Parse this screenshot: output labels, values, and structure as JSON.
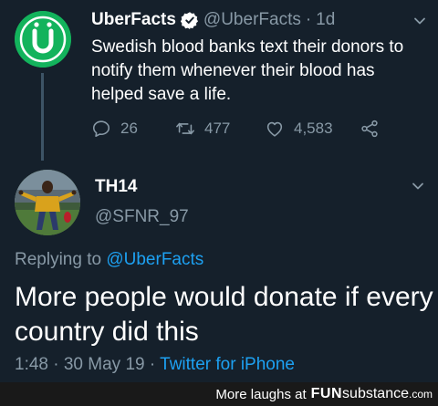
{
  "parent_tweet": {
    "name": "UberFacts",
    "handle": "@UberFacts",
    "separator": "·",
    "time": "1d",
    "text": "Swedish blood banks text their donors to notify them whenever their blood has helped save a life.",
    "replies": "26",
    "retweets": "477",
    "likes": "4,583"
  },
  "reply_tweet": {
    "name": "TH14",
    "handle": "@SFNR_97",
    "replying_prefix": "Replying to",
    "replying_to": "@UberFacts",
    "text": "More people would donate if every country did this",
    "timestamp": "1:48 · 30 May 19 ·",
    "source": "Twitter for iPhone"
  },
  "footer": {
    "prefix": "More laughs at",
    "brand_fun": "FUN",
    "brand_substance": "substance",
    "brand_com": ".com"
  },
  "colors": {
    "background": "#15202b",
    "secondary_text": "#8899a6",
    "link": "#1da1f2",
    "uberfacts_green": "#13b35c"
  },
  "icons": [
    "verified-badge-icon",
    "chevron-down-icon",
    "reply-icon",
    "retweet-icon",
    "like-icon",
    "share-icon"
  ]
}
